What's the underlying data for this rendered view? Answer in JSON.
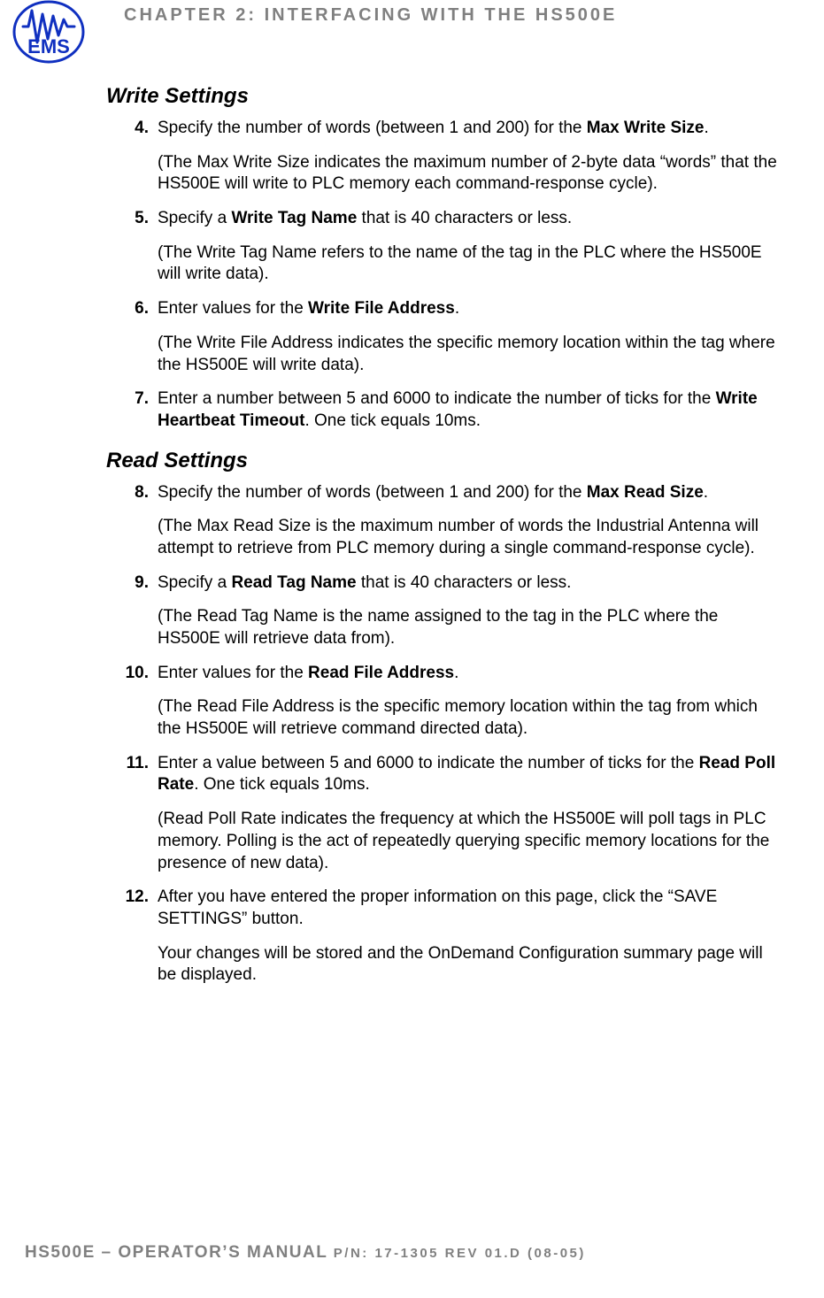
{
  "header": {
    "chapter": "CHAPTER 2: INTERFACING WITH THE HS500E"
  },
  "logo": {
    "text": "EMS"
  },
  "sections": {
    "write": {
      "title": "Write Settings",
      "items": [
        {
          "num": "4.",
          "line_pre": "Specify the number of words (between 1 and 200) for the ",
          "bold": "Max Write Size",
          "line_post": ".",
          "desc": "(The Max Write Size indicates the maximum number of 2-byte data “words” that the HS500E will write to PLC memory each command-response cycle)."
        },
        {
          "num": "5.",
          "line_pre": "Specify a ",
          "bold": "Write Tag Name",
          "line_post": " that is 40 characters or less.",
          "desc": "(The Write Tag Name refers to the name of the tag in the PLC where the HS500E will write data)."
        },
        {
          "num": "6.",
          "line_pre": "Enter values for the ",
          "bold": "Write File Address",
          "line_post": ".",
          "desc": "(The Write File Address indicates the specific memory location within the tag where the HS500E will write data)."
        },
        {
          "num": "7.",
          "line_pre": "Enter a number between 5 and 6000 to indicate the number of ticks for the ",
          "bold": "Write Heartbeat Timeout",
          "line_post": ". One tick equals 10ms.",
          "desc": ""
        }
      ]
    },
    "read": {
      "title": "Read Settings",
      "items": [
        {
          "num": "8.",
          "line_pre": "Specify the number of words (between 1 and 200) for the ",
          "bold": "Max Read Size",
          "line_post": ".",
          "desc": "(The Max Read Size is the maximum number of words the Industrial Antenna will attempt to retrieve from PLC memory during a single command-response cycle)."
        },
        {
          "num": "9.",
          "line_pre": "Specify a ",
          "bold": "Read Tag Name",
          "line_post": " that is 40 characters or less.",
          "desc": "(The Read Tag Name is the name assigned to the tag in the PLC where the HS500E will retrieve data from)."
        },
        {
          "num": "10.",
          "line_pre": "Enter values for the ",
          "bold": "Read File Address",
          "line_post": ".",
          "desc": "(The Read File Address is the specific memory location within the tag from which the HS500E will retrieve command directed data)."
        },
        {
          "num": "11.",
          "line_pre": "Enter a value between 5 and 6000 to indicate the number of ticks for the ",
          "bold": "Read Poll Rate",
          "line_post": ". One tick equals 10ms.",
          "desc": "(Read Poll Rate indicates the frequency at which the HS500E will poll tags in PLC memory. Polling is the act of repeatedly querying specific memory locations for the presence of new data)."
        },
        {
          "num": "12.",
          "line_pre": "After you have entered the proper information on this page, click the “SAVE SETTINGS” button.",
          "bold": "",
          "line_post": "",
          "desc": "Your changes will be stored and the OnDemand Configuration summary page will be displayed."
        }
      ]
    }
  },
  "footer": {
    "left": "HS500E – OPERATOR’S MANUAL ",
    "right": "P/N: 17-1305 REV 01.D (08-05)"
  }
}
